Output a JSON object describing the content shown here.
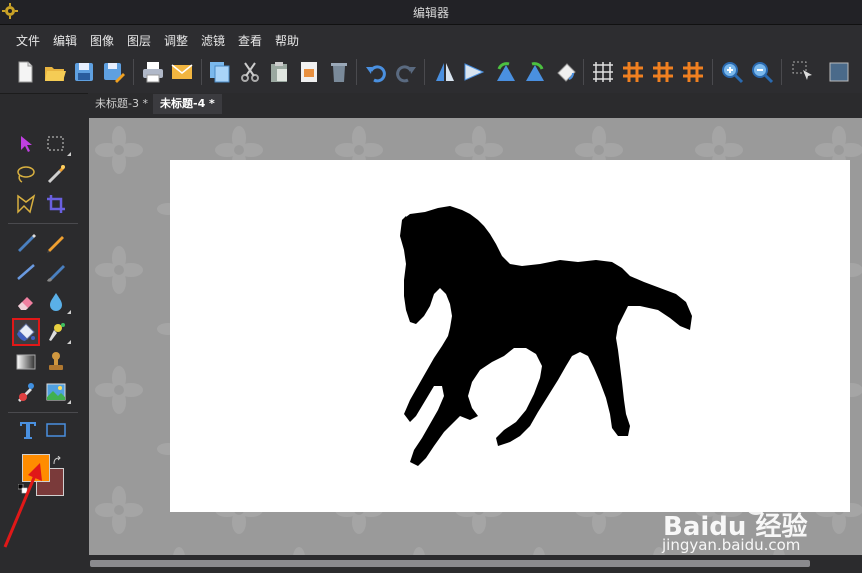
{
  "window": {
    "title": "编辑器"
  },
  "menu": [
    "文件",
    "编辑",
    "图像",
    "图层",
    "调整",
    "滤镜",
    "查看",
    "帮助"
  ],
  "tabs": [
    {
      "label": "未标题-3 *",
      "active": false
    },
    {
      "label": "未标题-4 *",
      "active": true
    }
  ],
  "colors": {
    "foreground": "#ff8c00",
    "background": "#7a3a3a",
    "accent": "#e01818"
  },
  "toolbar_icons": [
    "new-icon",
    "open-icon",
    "save-icon",
    "save-as-icon",
    "print-icon",
    "email-icon",
    "copy-icon",
    "cut-icon",
    "paste-icon",
    "paste-new-icon",
    "delete-icon",
    "undo-icon",
    "redo-icon",
    "flip-horizontal-icon",
    "flip-vertical-icon",
    "rotate-left-icon",
    "rotate-right-icon",
    "rotate-icon",
    "grid-icon",
    "hash-grid-icon",
    "hash-grid-2-icon",
    "hash-grid-3-icon",
    "zoom-in-icon",
    "zoom-out-icon",
    "select-area-icon",
    "crop-frame-icon"
  ],
  "tools_selected": "paint-bucket-tool",
  "watermark": {
    "brand": "Baidu 经验",
    "url": "jingyan.baidu.com"
  }
}
